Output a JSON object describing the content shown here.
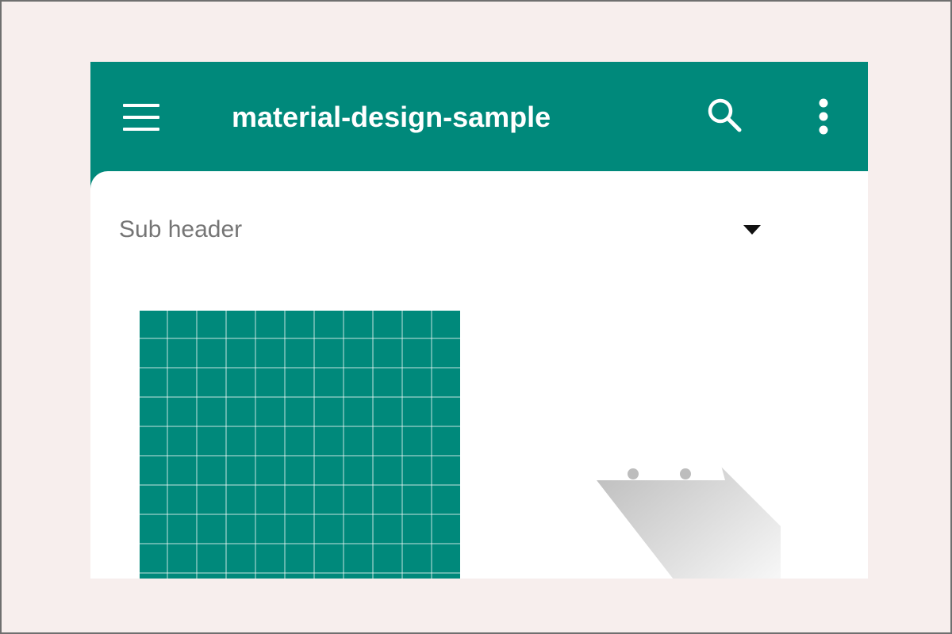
{
  "app": {
    "title": "material-design-sample"
  },
  "toolbar": {
    "menu_icon": "menu-icon",
    "search_icon": "search-icon",
    "more_icon": "more-vert-icon"
  },
  "subheader": {
    "label": "Sub header",
    "dropdown_icon": "arrow-drop-down-icon"
  },
  "colors": {
    "primary": "#00897b",
    "surface": "#ffffff",
    "background": "#f7eeed",
    "subheader_text": "#757575"
  }
}
